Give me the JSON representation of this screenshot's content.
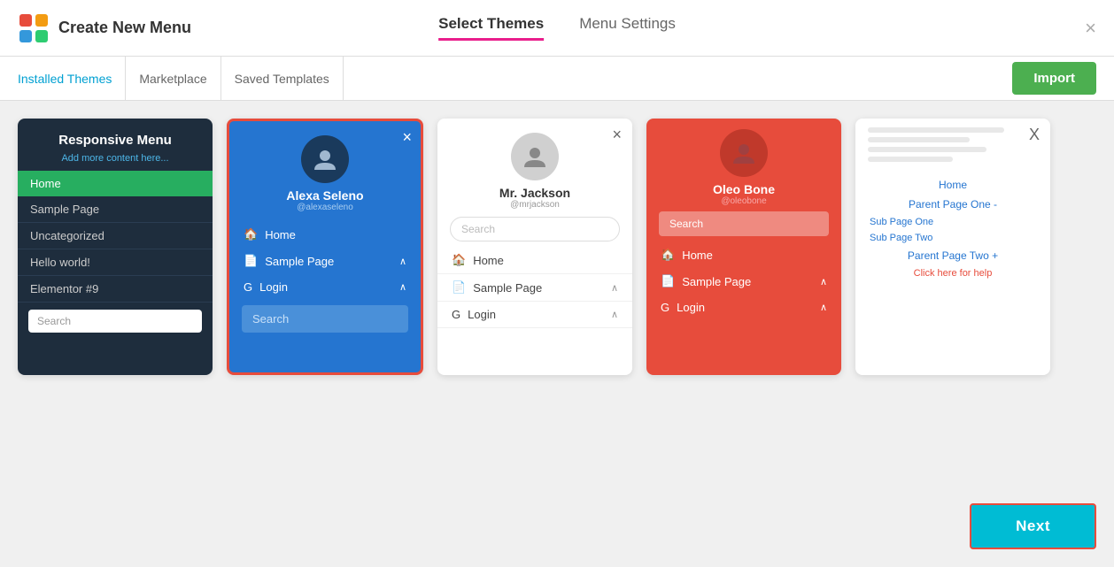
{
  "header": {
    "title": "Create New Menu",
    "tabs": [
      {
        "label": "Select Themes",
        "active": true
      },
      {
        "label": "Menu Settings",
        "active": false
      }
    ],
    "close_label": "×"
  },
  "sub_header": {
    "tabs": [
      {
        "label": "Installed Themes",
        "active": true
      },
      {
        "label": "Marketplace",
        "active": false
      },
      {
        "label": "Saved Templates",
        "active": false
      }
    ],
    "import_label": "Import"
  },
  "themes": [
    {
      "id": "responsive-menu",
      "title": "Responsive Menu",
      "subtitle": "Add more content here...",
      "menu_items": [
        "Home",
        "Sample Page",
        "Uncategorized",
        "Hello world!",
        "Elementor #9"
      ],
      "search_placeholder": "Search"
    },
    {
      "id": "alexa-seleno",
      "name": "Alexa Seleno",
      "handle": "@alexaseleno",
      "selected": true,
      "menu_items": [
        "Home",
        "Sample Page",
        "Login"
      ],
      "search_placeholder": "Search",
      "close_label": "×"
    },
    {
      "id": "mr-jackson",
      "name": "Mr. Jackson",
      "handle": "@mrjackson",
      "menu_items": [
        "Home",
        "Sample Page",
        "Login"
      ],
      "search_placeholder": "Search",
      "close_label": "×"
    },
    {
      "id": "oleo-bone",
      "name": "Oleo Bone",
      "handle": "@oleobone",
      "menu_items": [
        "Home",
        "Sample Page",
        "Login"
      ],
      "search_placeholder": "Search"
    },
    {
      "id": "theme-5",
      "links": [
        "Home",
        "Parent Page One -",
        "Sub Page One",
        "Sub Page Two",
        "Parent Page Two +"
      ],
      "close_label": "X",
      "help_text": "Click here for help"
    }
  ],
  "next_button": {
    "label": "Next"
  }
}
